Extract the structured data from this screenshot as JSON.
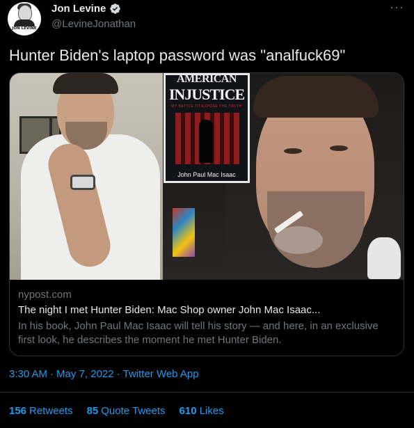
{
  "author": {
    "name": "Jon Levine",
    "handle": "@LevineJonathan",
    "avatar_text": "JON LEVINE",
    "verified": true
  },
  "tweet": {
    "text": "Hunter Biden's laptop password was \"analfuck69\"",
    "more_icon": "···"
  },
  "link_card": {
    "book": {
      "title_top": "AMERICAN",
      "title_main": "INJUSTICE",
      "subtitle": "MY BATTLE TO EXPOSE THE TRUTH",
      "author": "John Paul Mac Isaac"
    },
    "domain": "nypost.com",
    "title": "The night I met Hunter Biden: Mac Shop owner John Mac Isaac...",
    "description": "In his book, John Paul Mac Isaac will tell his story — and here, in an exclusive first look, he describes the moment he met Hunter Biden."
  },
  "meta": {
    "time": "3:30 AM",
    "separator1": "·",
    "date": "May 7, 2022",
    "separator2": "·",
    "source": "Twitter Web App"
  },
  "stats": [
    {
      "count": "156",
      "label": "Retweets"
    },
    {
      "count": "85",
      "label": "Quote Tweets"
    },
    {
      "count": "610",
      "label": "Likes"
    }
  ],
  "colors": {
    "background": "#000000",
    "text": "#e7e9ea",
    "secondary": "#71767b",
    "accent": "#1d9bf0",
    "border": "#2f3336"
  }
}
